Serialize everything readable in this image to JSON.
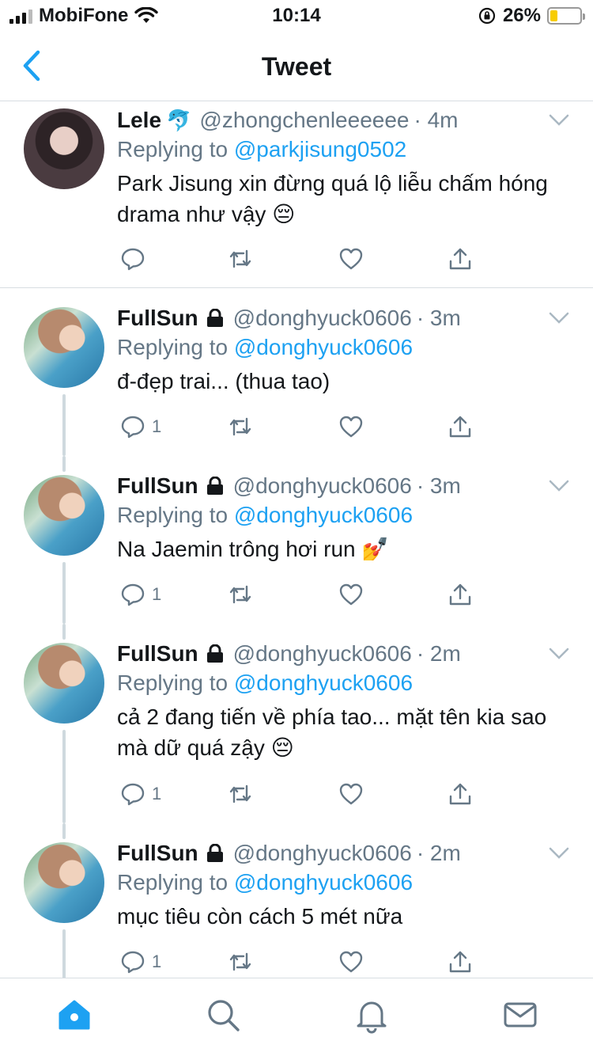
{
  "status_bar": {
    "carrier": "MobiFone",
    "time": "10:14",
    "battery_percent": "26%",
    "battery_level": 0.26,
    "icons": [
      "signal-icon",
      "wifi-icon",
      "orientation-lock-icon",
      "battery-icon"
    ]
  },
  "nav": {
    "title": "Tweet",
    "back_icon": "chevron-left-icon"
  },
  "tweets": [
    {
      "name": "Lele",
      "badge": "🐬",
      "handle": "@zhongchenleeeeee",
      "time": "· 4m",
      "replying_prefix": "Replying to ",
      "replying_to": "@parkjisung0502",
      "text": "Park Jisung xin đừng quá lộ liễu chấm hóng drama như vậy 😔",
      "reply_count": ""
    },
    {
      "name": "FullSun",
      "handle": "@donghyuck0606",
      "time": "· 3m",
      "replying_prefix": "Replying to ",
      "replying_to": "@donghyuck0606",
      "text": "đ-đẹp trai... (thua tao)",
      "reply_count": "1"
    },
    {
      "name": "FullSun",
      "handle": "@donghyuck0606",
      "time": "· 3m",
      "replying_prefix": "Replying to ",
      "replying_to": "@donghyuck0606",
      "text": "Na Jaemin trông hơi run 💅",
      "reply_count": "1"
    },
    {
      "name": "FullSun",
      "handle": "@donghyuck0606",
      "time": "· 2m",
      "replying_prefix": "Replying to ",
      "replying_to": "@donghyuck0606",
      "text": "cả 2 đang tiến về phía tao... mặt tên kia sao mà dữ quá zậy 😔",
      "reply_count": "1"
    },
    {
      "name": "FullSun",
      "handle": "@donghyuck0606",
      "time": "· 2m",
      "replying_prefix": "Replying to ",
      "replying_to": "@donghyuck0606",
      "text": "mục tiêu còn cách 5 mét nữa",
      "reply_count": "1"
    }
  ],
  "tab_bar": {
    "tabs": [
      "home-icon",
      "search-icon",
      "notifications-icon",
      "messages-icon"
    ],
    "active_color": "#1da1f2"
  },
  "colors": {
    "accent": "#1da1f2",
    "secondary_text": "#657786",
    "divider": "#d8dde2"
  }
}
